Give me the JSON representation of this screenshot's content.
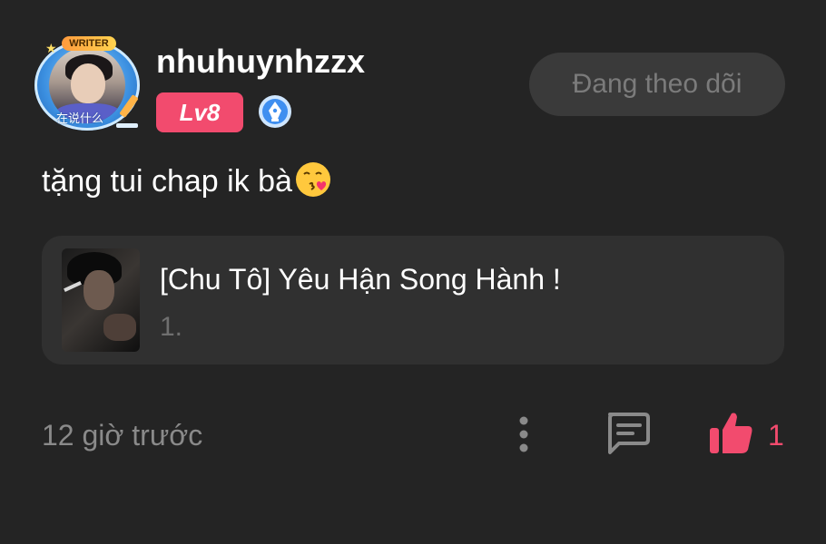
{
  "post": {
    "author": {
      "username": "nhuhuynhzzx",
      "level_label": "Lv8",
      "frame_badge_text": "WRITER",
      "frame_caption": "在说什么",
      "avatar_icon": "user-avatar",
      "author_badge_icon": "pen-nib-badge-icon"
    },
    "follow_button_label": "Đang theo dõi",
    "comment_text": "tặng tui chap ik bà",
    "comment_emoji": "kissing-face-with-heart-emoji",
    "story": {
      "title": "[Chu Tô] Yêu Hận Song Hành !",
      "chapter": "1."
    },
    "footer": {
      "timestamp": "12 giờ trước",
      "like_count": "1",
      "icons": [
        "more-vertical-icon",
        "comment-icon",
        "thumbs-up-icon"
      ]
    }
  },
  "colors": {
    "background": "#242424",
    "card": "#303030",
    "accent": "#f24b6e",
    "follow_button_bg": "#3a3a3a",
    "muted_text": "#8a8a8a"
  }
}
